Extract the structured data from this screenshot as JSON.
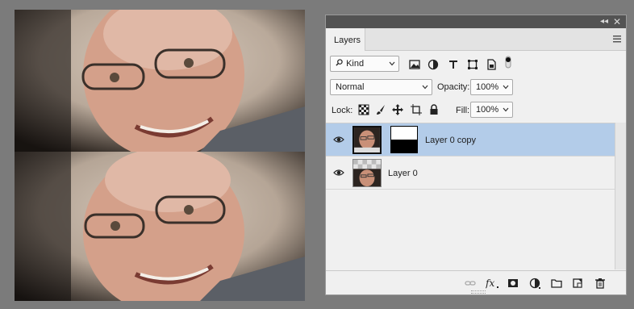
{
  "panel": {
    "tab_label": "Layers",
    "filter": {
      "kind_label": "Kind"
    },
    "blend_mode": "Normal",
    "opacity_label": "Opacity:",
    "opacity_value": "100%",
    "lock_label": "Lock:",
    "fill_label": "Fill:",
    "fill_value": "100%",
    "layers": [
      {
        "name": "Layer 0 copy",
        "selected": true,
        "visible": true,
        "has_mask": true
      },
      {
        "name": "Layer 0",
        "selected": false,
        "visible": true,
        "has_mask": false
      }
    ]
  },
  "colors": {
    "selection": "#b3cce9",
    "panel_bg": "#f0f0f0",
    "workspace_bg": "#7b7b7b"
  },
  "icons": {
    "titlebar": [
      "collapse-icon",
      "close-icon"
    ],
    "filter": [
      "search-icon",
      "pixel-filter-icon",
      "adjustment-filter-icon",
      "type-filter-icon",
      "shape-filter-icon",
      "smart-object-filter-icon",
      "filter-toggle-icon"
    ],
    "lock": [
      "lock-transparent-icon",
      "lock-image-icon",
      "lock-position-icon",
      "lock-artboard-icon",
      "lock-all-icon"
    ],
    "bottom": [
      "link-layers-icon",
      "fx-icon",
      "add-mask-icon",
      "adjustment-layer-icon",
      "new-group-icon",
      "new-layer-icon",
      "delete-layer-icon"
    ]
  }
}
